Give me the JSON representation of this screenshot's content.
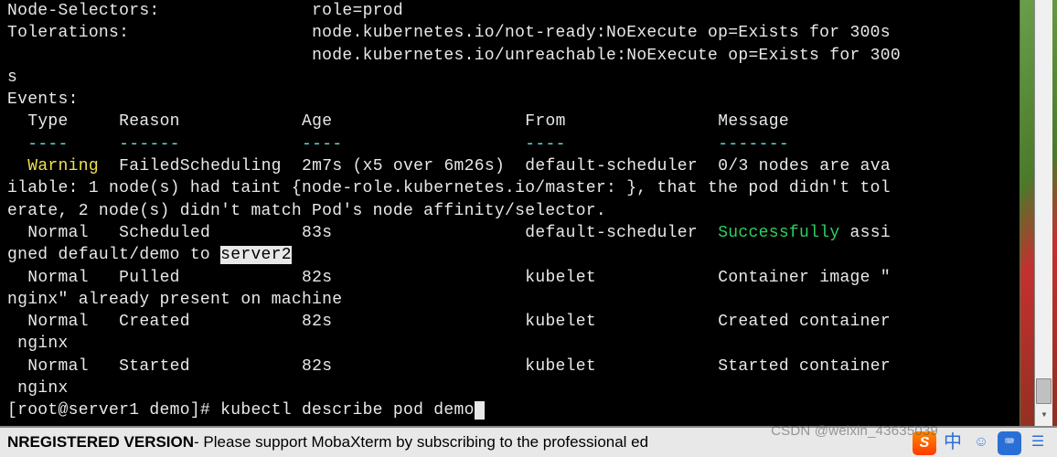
{
  "terminal": {
    "node_selectors_label": "Node-Selectors:",
    "node_selectors_value": "role=prod",
    "tolerations_label": "Tolerations:",
    "toleration1": "node.kubernetes.io/not-ready:NoExecute op=Exists for 300s",
    "toleration2_part1": "node.kubernetes.io/unreachable:NoExecute op=Exists for 300",
    "toleration2_wrap": "s",
    "events_label": "Events:",
    "events_header": {
      "type": "Type",
      "reason": "Reason",
      "age": "Age",
      "from": "From",
      "message": "Message"
    },
    "dashes": {
      "type": "----",
      "reason": "------",
      "age": "----",
      "from": "----",
      "message": "-------"
    },
    "ev1": {
      "type": "Warning",
      "reason": "FailedScheduling",
      "age": "2m7s (x5 over 6m26s)",
      "from": "default-scheduler",
      "msg_part1": "0/3 nodes are ava",
      "msg_wrap1": "ilable: 1 node(s) had taint {node-role.kubernetes.io/master: }, that the pod didn't tol",
      "msg_wrap2": "erate, 2 node(s) didn't match Pod's node affinity/selector."
    },
    "ev2": {
      "type": "Normal",
      "reason": "Scheduled",
      "age": "83s",
      "from": "default-scheduler",
      "msg_success": "Successfully",
      "msg_tail1": " assi",
      "msg_wrap_pre": "gned default/demo to ",
      "msg_highlight": "server2"
    },
    "ev3": {
      "type": "Normal",
      "reason": "Pulled",
      "age": "82s",
      "from": "kubelet",
      "msg_part1": "Container image \"",
      "msg_wrap": "nginx\" already present on machine"
    },
    "ev4": {
      "type": "Normal",
      "reason": "Created",
      "age": "82s",
      "from": "kubelet",
      "msg": "Created container",
      "msg_wrap": " nginx"
    },
    "ev5": {
      "type": "Normal",
      "reason": "Started",
      "age": "82s",
      "from": "kubelet",
      "msg": "Started container",
      "msg_wrap": " nginx"
    },
    "prompt_user": "[root@server1 demo]# ",
    "prompt_command": "kubectl describe pod demo"
  },
  "statusbar": {
    "unregistered": "NREGISTERED VERSION",
    "text": "  -  Please support MobaXterm by subscribing to the professional ed"
  },
  "watermark": "CSDN @weixin_43635039",
  "tray": {
    "sogo": "S",
    "zhong": "中",
    "smiley": "☺",
    "kb_icon": "⌨",
    "menu": "☰"
  }
}
